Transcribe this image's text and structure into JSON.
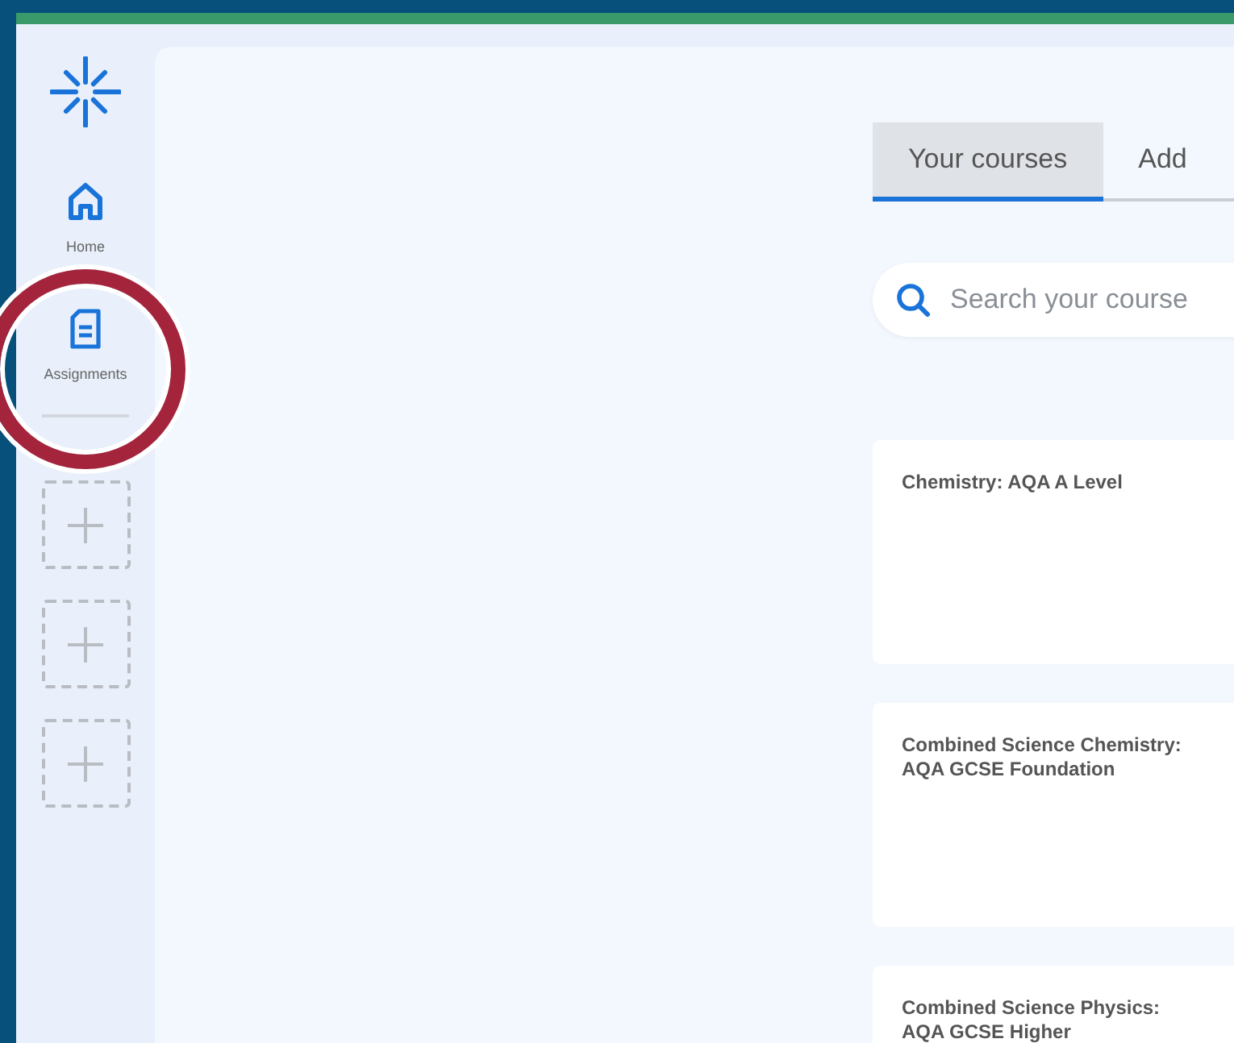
{
  "sidebar": {
    "items": [
      {
        "label": "Home",
        "kind": "home"
      },
      {
        "label": "Assignments",
        "kind": "assignments"
      }
    ],
    "add_slots": [
      {
        "kind": "empty"
      },
      {
        "kind": "empty"
      },
      {
        "kind": "empty"
      }
    ]
  },
  "annotation": {
    "kind": "circle",
    "color": "#a4243b"
  },
  "tabs": [
    {
      "label": "Your courses",
      "selected": true
    },
    {
      "label": "Add",
      "selected": false
    }
  ],
  "search": {
    "placeholder": "Search your course"
  },
  "courses": [
    {
      "title": "Chemistry: AQA A Level"
    },
    {
      "title": "Combined Science Chemistry: AQA GCSE Foundation"
    },
    {
      "title": "Combined Science Physics: AQA GCSE Higher"
    }
  ]
}
